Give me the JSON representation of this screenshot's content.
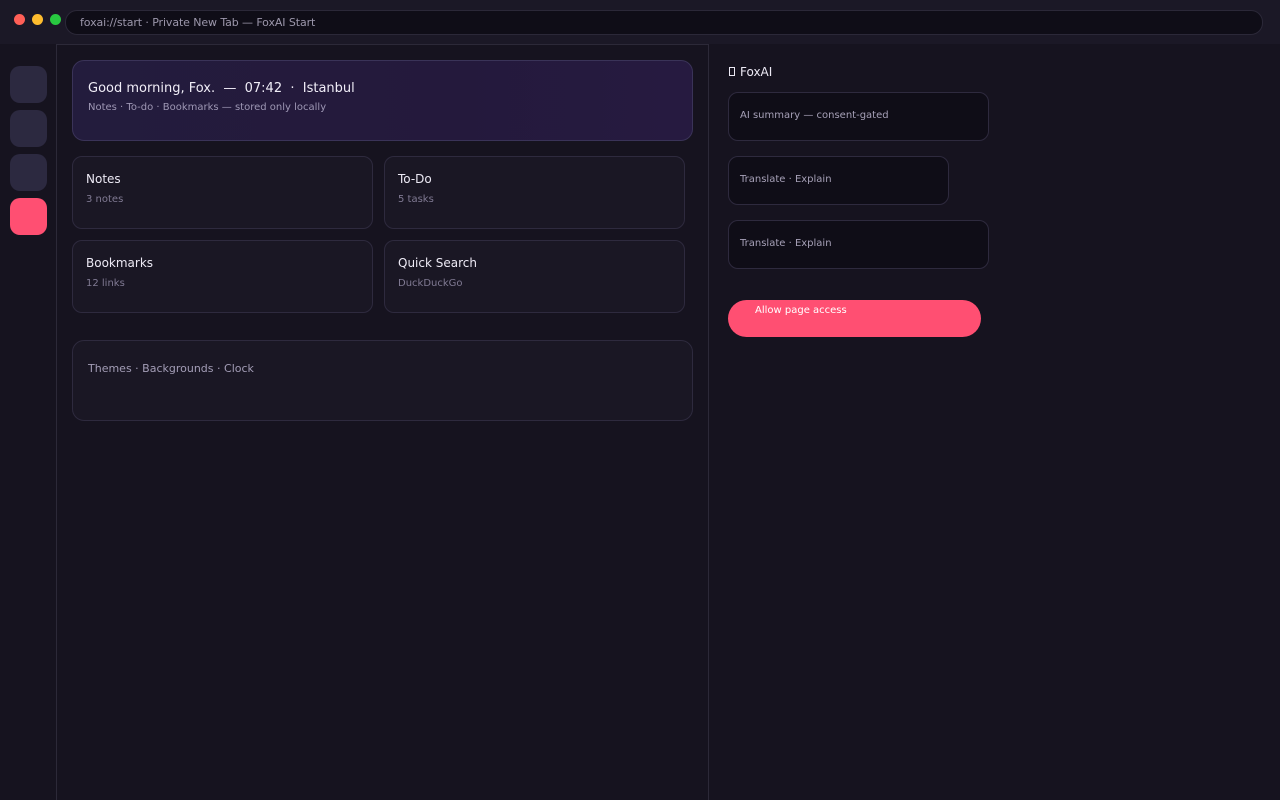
{
  "window": {
    "url_text": "foxai://start · Private New Tab — FoxAI Start"
  },
  "rail": {
    "items": [
      {
        "icon": "rail-icon-1",
        "active": false
      },
      {
        "icon": "rail-icon-2",
        "active": false
      },
      {
        "icon": "rail-icon-3",
        "active": false
      },
      {
        "icon": "rail-icon-4",
        "active": true
      }
    ],
    "accent_color": "#ff4f72"
  },
  "hero": {
    "title": "Good morning, Fox.  —  07:42  ·  Istanbul",
    "subtitle": "Notes · To-do · Bookmarks — stored only locally"
  },
  "cards": [
    {
      "title": "Notes",
      "sub": "3 notes"
    },
    {
      "title": "To-Do",
      "sub": "5 tasks"
    },
    {
      "title": "Bookmarks",
      "sub": "12 links"
    },
    {
      "title": "Quick Search",
      "sub": "DuckDuckGo"
    }
  ],
  "themes": {
    "label": "Themes · Backgrounds · Clock"
  },
  "ai_panel": {
    "title": "FoxAI",
    "cards": [
      "AI summary — consent-gated",
      "Translate · Explain",
      "Translate · Explain"
    ],
    "allow_button": "Allow page access"
  }
}
